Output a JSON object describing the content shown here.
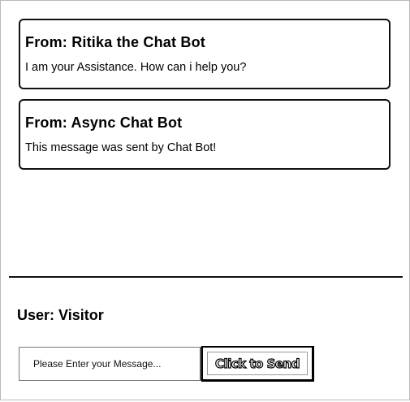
{
  "messages": [
    {
      "from": "From: Ritika the Chat Bot",
      "text": "I am your Assistance. How can i help you?"
    },
    {
      "from": "From: Async Chat Bot",
      "text": "This message was sent by Chat Bot!"
    }
  ],
  "user": {
    "label": "User: Visitor"
  },
  "composer": {
    "placeholder": "Please Enter your Message...",
    "value": "",
    "send_label": "Click to Send"
  }
}
